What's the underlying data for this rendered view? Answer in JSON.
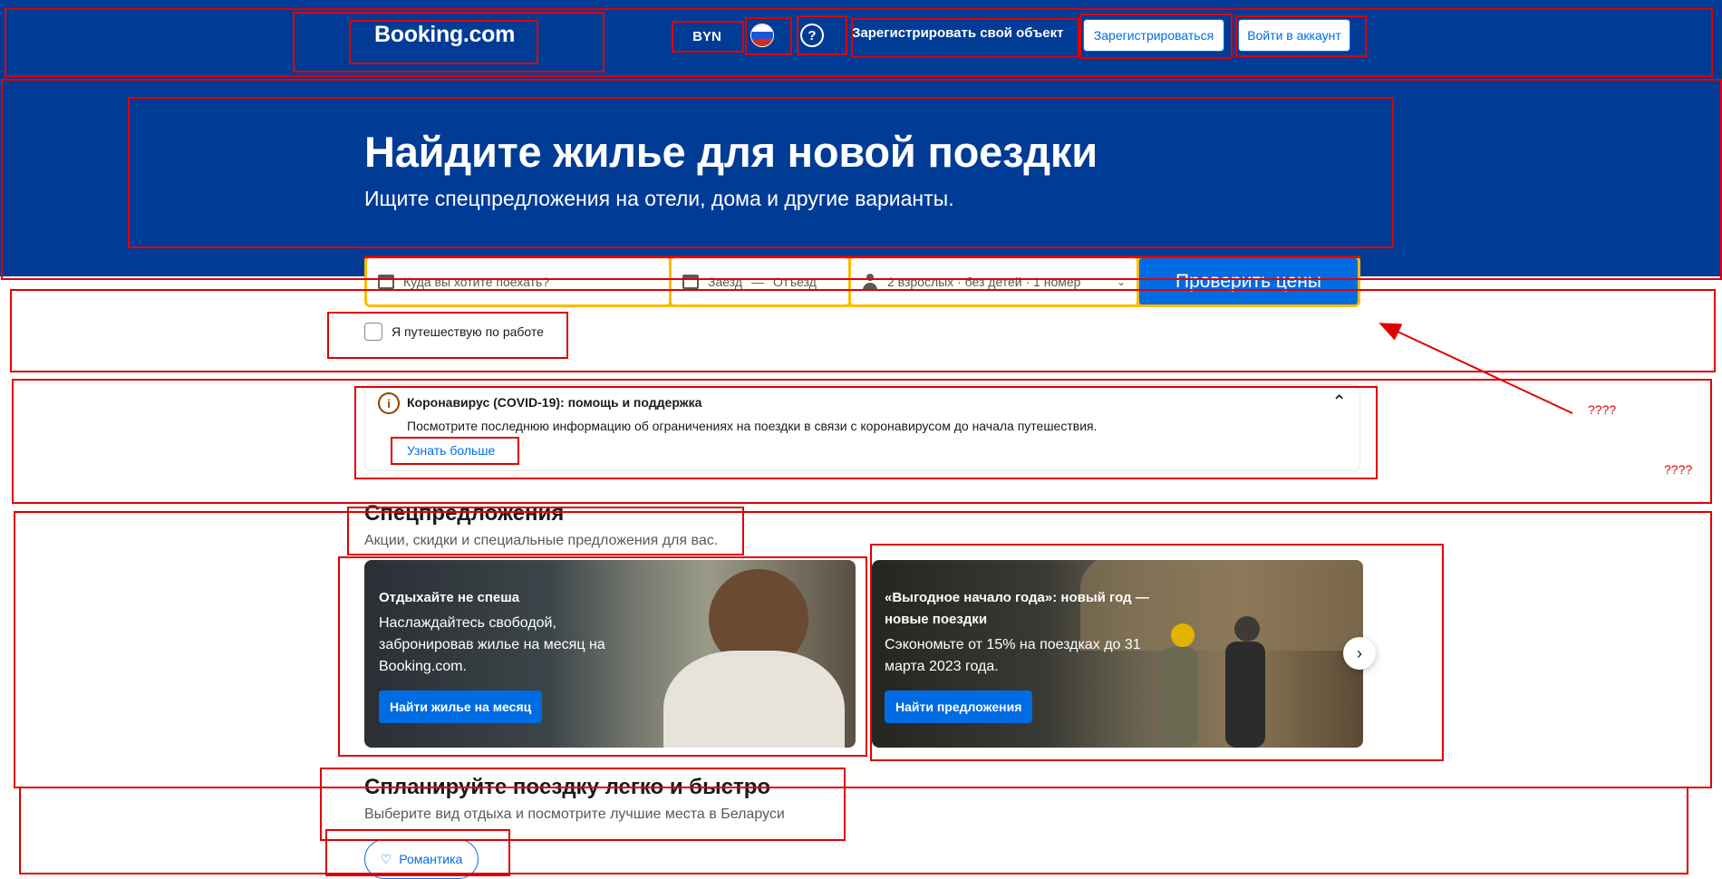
{
  "header": {
    "logo": "Booking.com",
    "currency": "BYN",
    "list_property": "Зарегистрировать свой объект",
    "register": "Зарегистрироваться",
    "login": "Войти в аккаунт"
  },
  "hero": {
    "title": "Найдите жилье для новой поездки",
    "subtitle": "Ищите спецпредложения на отели, дома и другие варианты."
  },
  "search": {
    "destination_placeholder": "Куда вы хотите поехать?",
    "checkin": "Заезд",
    "separator": "—",
    "checkout": "Отъезд",
    "guests": "2 взрослых · без детей · 1 номер",
    "submit": "Проверить цены",
    "work_trip": "Я путешествую по работе"
  },
  "notice": {
    "title": "Коронавирус (COVID-19): помощь и поддержка",
    "text": "Посмотрите последнюю информацию об ограничениях на поездки в связи с коронавирусом до начала путешествия.",
    "link": "Узнать больше"
  },
  "offers": {
    "title": "Спецпредложения",
    "subtitle": "Акции, скидки и специальные предложения для вас.",
    "cards": [
      {
        "title": "Отдыхайте не спеша",
        "desc": "Наслаждайтесь свободой, забронировав жилье на месяц на Booking.com.",
        "button": "Найти жилье на месяц"
      },
      {
        "title": "«Выгодное начало года»: новый год — новые поездки",
        "desc": "Сэкономьте от 15% на поездках до 31 марта 2023 года.",
        "button": "Найти предложения"
      }
    ]
  },
  "plan": {
    "title": "Спланируйте поездку легко и быстро",
    "subtitle": "Выберите вид отдыха и посмотрите лучшие места в Беларуси",
    "chip": "Романтика"
  },
  "annotations": {
    "note_1": "????",
    "note_2": "????"
  },
  "colors": {
    "brand_blue": "#003b95",
    "action_blue": "#006ce4",
    "search_border": "#ffbb00",
    "annotation_red": "#e00000"
  },
  "icons": [
    "bed-icon",
    "calendar-icon",
    "person-icon",
    "info-icon",
    "chevron-up-icon",
    "chevron-right-icon",
    "heart-icon",
    "help-icon",
    "flag-icon"
  ]
}
